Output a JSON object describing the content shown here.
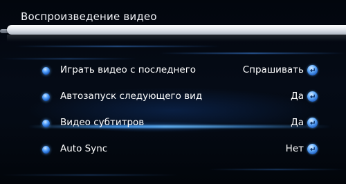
{
  "header": {
    "title": "Воспроизведение видео"
  },
  "menu": {
    "items": [
      {
        "label": "Играть видео с последнего",
        "value": "Спрашивать",
        "selected": false
      },
      {
        "label": "Автозапуск следующего вид",
        "value": "Да",
        "selected": false
      },
      {
        "label": "Видео субтитров",
        "value": "Да",
        "selected": true
      },
      {
        "label": "Auto Sync",
        "value": "Нет",
        "selected": false
      }
    ]
  },
  "icons": {
    "bullet": "blue-orb-bullet-icon",
    "enter": "enter-return-icon"
  },
  "colors": {
    "background": "#040a14",
    "accent": "#3f8cff",
    "header_bar": "#e4e8ee",
    "text": "#ffffff"
  }
}
